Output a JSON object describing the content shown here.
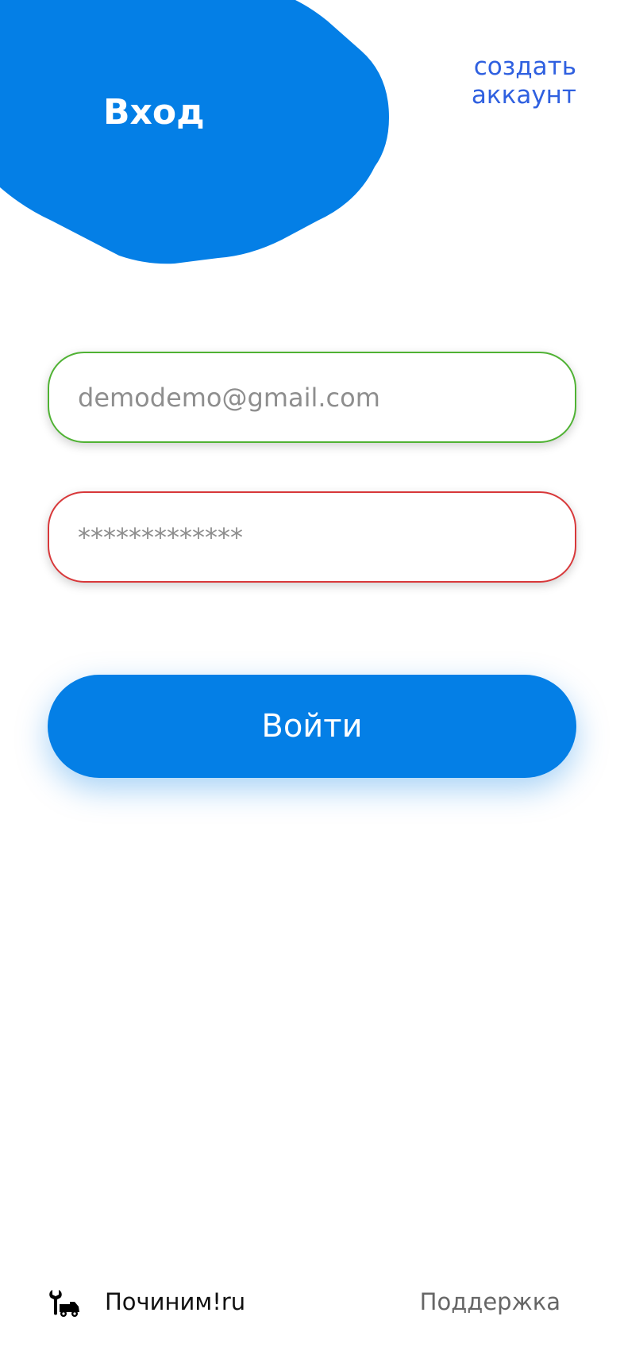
{
  "header": {
    "title": "Вход",
    "create_account_line1": "создать",
    "create_account_line2": "аккаунт",
    "accent_color": "#047fe6",
    "link_color": "#2f60e0"
  },
  "form": {
    "email_value": "demodemo@gmail.com",
    "email_border_color": "#4fb233",
    "password_value": "*************",
    "password_border_color": "#d8383a",
    "submit_label": "Войти"
  },
  "footer": {
    "brand_icon": "repair-truck-icon",
    "brand_name": "Починим!ru",
    "support_label": "Поддержка"
  }
}
